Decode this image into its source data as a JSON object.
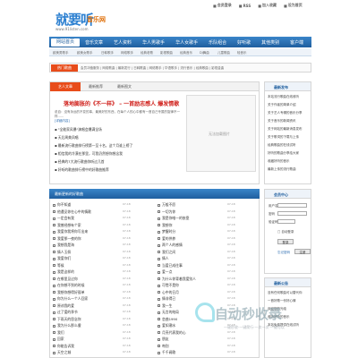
{
  "logo": {
    "main": "就要听",
    "sub": "音乐网",
    "url": "www.91listen.com"
  },
  "toplinks": [
    "会员登录",
    "RSS",
    "加入收藏",
    "设为首页"
  ],
  "nav": [
    "网站首页",
    "音乐文章",
    "艺人资料",
    "华人男歌手",
    "华人女歌手",
    "乐队组合",
    "好听歌",
    "其他类别",
    "客户端"
  ],
  "subbar": [
    "欧美男歌手",
    "欧美女歌手",
    "日韩歌手",
    "网络歌手",
    "经典老歌",
    "影视歌曲",
    "经典音乐",
    "DJ舞曲",
    "儿童歌曲",
    "轻音乐"
  ],
  "search": {
    "label": "热门歌曲",
    "words": "会员冲值服务 | 网络歌曲 | 最新发行 | 日韩歌曲 | 网络歌手 | 华语歌手 | 流行音乐 | 经典歌曲 | 影视金曲"
  },
  "tabs": [
    "艺人文章",
    "最新推荐",
    "最新图文"
  ],
  "headline": "落地膨胀的《不一样》 – 一首励志感人 爆发情歌",
  "intro": "说自：没有永远的不变的事，最美好的东西，在每个人的心中都有一首自己专属的旋律不一样......",
  "more_link": "[详细内容]",
  "news": [
    {
      "title": "\"全能家风暴\"演唱会爆满全场",
      "date": "07-18"
    },
    {
      "title": "天后周美凤唱",
      "date": "07-16"
    },
    {
      "title": "最新流行歌曲排行榜第一至十名，这个月谁上榜了",
      "date": "07-13"
    },
    {
      "title": "相信我的冷漠在那里，可我仍然想你想念我",
      "date": "07-11"
    },
    {
      "title": "经典的7大流行歌曲你听过几首",
      "date": "07-10"
    },
    {
      "title": "好听的歌曲排行榜中的好歌曲推荐",
      "date": "07-09"
    }
  ],
  "image_placeholder": "无法加载图片",
  "login_title": "最新发布",
  "login_items": [
    "本站流行歌曲在线收听",
    "关于作者的简单介绍",
    "关于艺人专辑的音乐分享",
    "关于音乐的新闻资讯",
    "关于网站的最新消息发布",
    "关于歌词的下载与上传",
    "经典歌曲的在线试听",
    "好听的歌曲分享给大家",
    "收藏好听的音乐",
    "最新上传的流行歌曲"
  ],
  "songlist_title": "最新更新的好歌曲",
  "songs_left": [
    {
      "name": "你不知道",
      "date": "07-18"
    },
    {
      "name": "他遇见你在心中的情歌",
      "date": "07-18"
    },
    {
      "name": "一定会有我",
      "date": "07-18"
    },
    {
      "name": "我曾经想有个家",
      "date": "07-18"
    },
    {
      "name": "我爱你我将你写出来",
      "date": "07-18"
    },
    {
      "name": "我爱那一夜的你",
      "date": "07-18"
    },
    {
      "name": "我想我是海",
      "date": "07-18"
    },
    {
      "name": "情人玉佩",
      "date": "07-18"
    },
    {
      "name": "我爱你们",
      "date": "07-18"
    },
    {
      "name": "等候",
      "date": "07-18"
    },
    {
      "name": "我是这样的",
      "date": "07-18"
    },
    {
      "name": "在哪里见过你",
      "date": "07-18"
    },
    {
      "name": "在你想不到的时候",
      "date": "07-18"
    },
    {
      "name": "我想你想得好孤单",
      "date": "07-18"
    },
    {
      "name": "你为什么一个人回家",
      "date": "07-18"
    },
    {
      "name": "原谅我的爱",
      "date": "07-18"
    },
    {
      "name": "过了爱的季节",
      "date": "07-18"
    },
    {
      "name": "下雨天的思念你",
      "date": "07-18"
    },
    {
      "name": "我为什么那么傻",
      "date": "07-18"
    },
    {
      "name": "我们",
      "date": "07-18"
    },
    {
      "name": "回家",
      "date": "07-18"
    },
    {
      "name": "你能告诉我",
      "date": "07-18"
    },
    {
      "name": "天空之城",
      "date": "07-18"
    }
  ],
  "songs_right": [
    {
      "name": "万般不愿",
      "date": "07-18"
    },
    {
      "name": "一切为你",
      "date": "07-18"
    },
    {
      "name": "我是你唯一的依靠",
      "date": "07-18"
    },
    {
      "name": "我想你",
      "date": "07-18"
    },
    {
      "name": "梦醒时分",
      "date": "07-18"
    },
    {
      "name": "爱的供养",
      "date": "07-18"
    },
    {
      "name": "两个人的感情",
      "date": "07-18"
    },
    {
      "name": "我们之间",
      "date": "07-18"
    },
    {
      "name": "情人",
      "date": "07-18"
    },
    {
      "name": "当爱已成往事",
      "date": "07-18"
    },
    {
      "name": "爱一点",
      "date": "07-18"
    },
    {
      "name": "为什么你背着我爱别人",
      "date": "07-18"
    },
    {
      "name": "可惜不是你",
      "date": "07-18"
    },
    {
      "name": "心中的日月",
      "date": "07-18"
    },
    {
      "name": "情非得已",
      "date": "07-18"
    },
    {
      "name": "我一生",
      "date": "07-18"
    },
    {
      "name": "无言的结局",
      "date": "07-18"
    },
    {
      "name": "恋曲1990",
      "date": "07-18"
    },
    {
      "name": "爱如潮水",
      "date": "07-18"
    },
    {
      "name": "月亮代表我的心",
      "date": "07-18"
    },
    {
      "name": "朋友",
      "date": "07-18"
    },
    {
      "name": "吻别",
      "date": "07-18"
    },
    {
      "name": "千千阙歌",
      "date": "07-18"
    }
  ],
  "member": {
    "title": "会员中心",
    "user_label": "用户名",
    "pass_label": "密码",
    "code_label": "验证码",
    "remember": "自动登录",
    "login_btn": "登录",
    "register": "忘记密码",
    "reg_btn": "注册"
  },
  "notice": {
    "title": "最新公告",
    "items": [
      "没有任何歌曲可以替代你",
      "一首好歌一份好心情",
      "欢迎您的光临",
      "收听好听的音乐",
      "本站免费提供在线试听"
    ]
  },
  "watermark": {
    "main": "自动秒收录",
    "sub": "一键秒收·一键爬行·一次一次·一键可以"
  }
}
